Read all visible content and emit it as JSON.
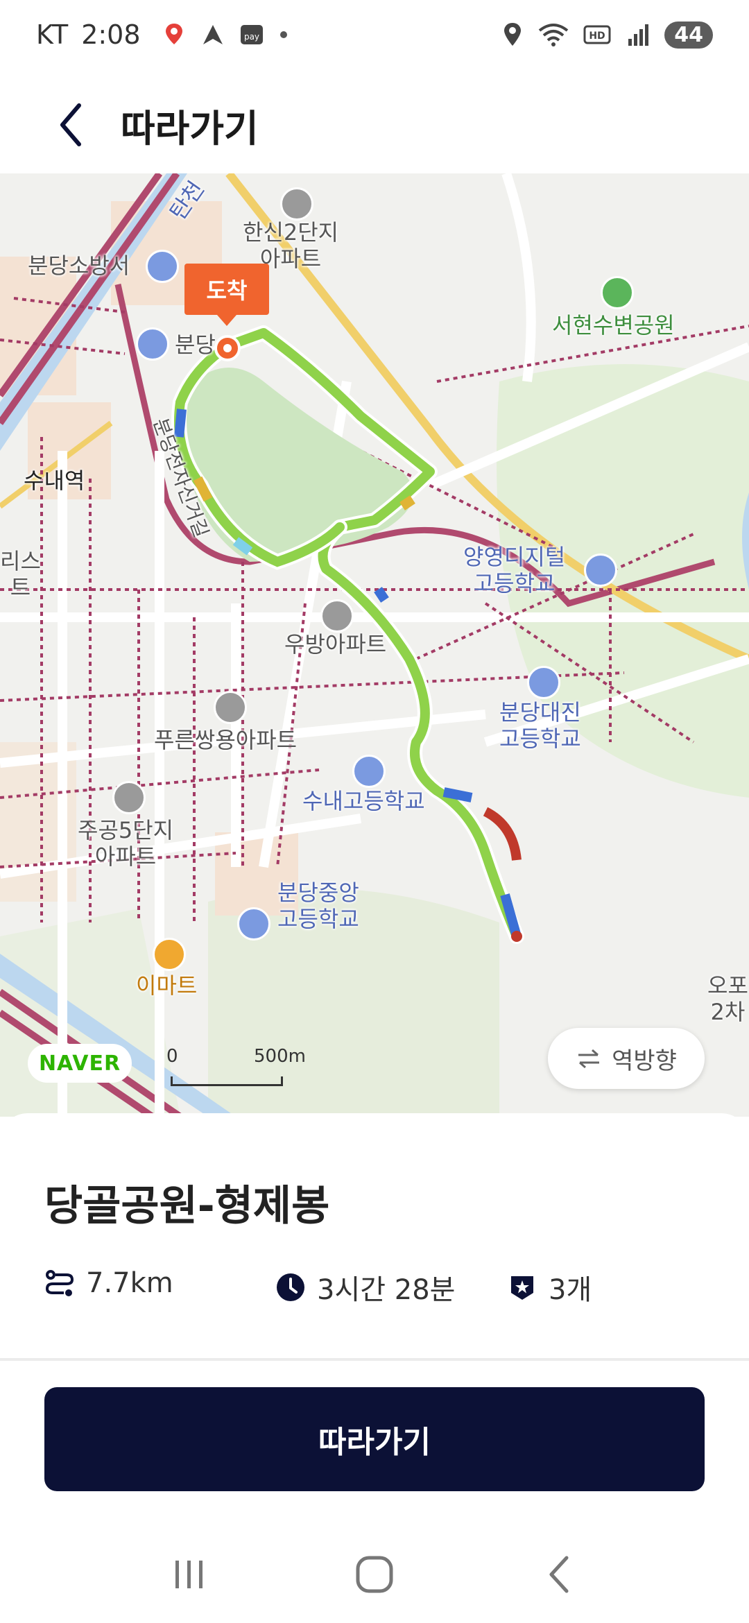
{
  "status_bar": {
    "carrier": "KT",
    "time": "2:08",
    "battery": "44",
    "icons": [
      "map-pin-icon",
      "navigation-icon",
      "pay-icon",
      "dot-icon",
      "location-icon",
      "wifi-icon",
      "hd-icon",
      "signal-icon",
      "battery-icon"
    ]
  },
  "header": {
    "title": "따라가기",
    "back_icon": "chevron-left-icon"
  },
  "map": {
    "arrival_tag": "도착",
    "labels": {
      "hanshin": "한신2단지\n아파트",
      "bundang_fire": "분당소방서",
      "bundang_station": "분당",
      "seohyeon_park": "서현수변공원",
      "sunae_station": "수내역",
      "yangyeong": "양영디지털\n고등학교",
      "ubang": "우방아파트",
      "bundang_daejin": "분당대진\n고등학교",
      "pureun": "푸른쌍용아파트",
      "sunae_high": "수내고등학교",
      "jugong": "주공5단지\n아파트",
      "bundang_jungang": "분당중앙\n고등학교",
      "emart": "이마트",
      "tancheon": "탄천",
      "road_label": "분당전자신거길",
      "left_cut": "리스\n트",
      "right_cut": "오포\n2차"
    },
    "naver": "NAVER",
    "scale_zero": "0",
    "scale_dist": "500m",
    "reverse_button": "역방향"
  },
  "course": {
    "name": "당골공원-형제봉",
    "distance": "7.7km",
    "duration": "3시간 28분",
    "stamps": "3개"
  },
  "follow_button": "따라가기",
  "nav": [
    "recent-apps-icon",
    "home-icon",
    "back-icon"
  ],
  "colors": {
    "primary": "#0c1136",
    "arrival": "#f0642e",
    "route": "#8fd24a",
    "road_main": "#b04a6e",
    "naver": "#2db400"
  }
}
